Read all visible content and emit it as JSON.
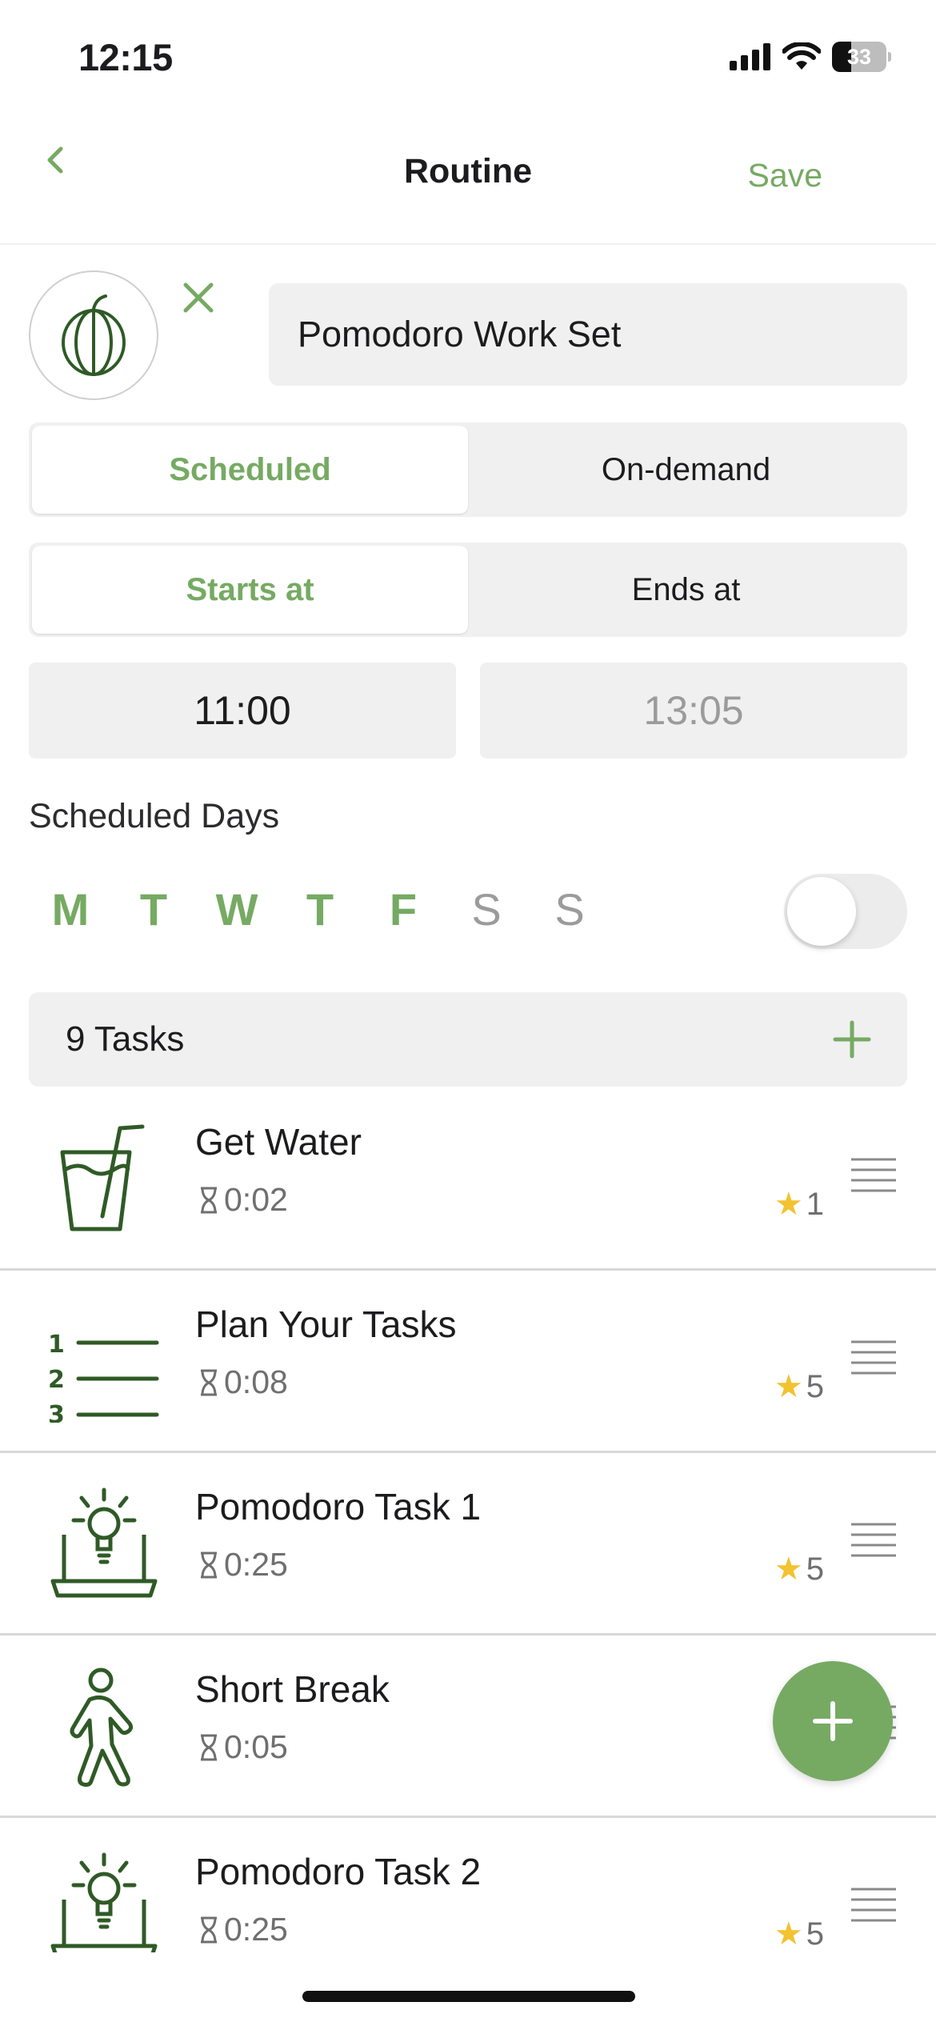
{
  "status_bar": {
    "time": "12:15",
    "battery": "33"
  },
  "nav": {
    "title": "Routine",
    "save_label": "Save"
  },
  "routine": {
    "name": "Pomodoro Work Set",
    "icon": "pumpkin-icon"
  },
  "mode_toggle": {
    "options": [
      "Scheduled",
      "On-demand"
    ],
    "selected": "Scheduled"
  },
  "time_toggle": {
    "options": [
      "Starts at",
      "Ends at"
    ],
    "selected": "Starts at"
  },
  "times": {
    "start": "11:00",
    "end": "13:05"
  },
  "schedule": {
    "label": "Scheduled Days",
    "days": [
      {
        "letter": "M",
        "active": true
      },
      {
        "letter": "T",
        "active": true
      },
      {
        "letter": "W",
        "active": true
      },
      {
        "letter": "T",
        "active": true
      },
      {
        "letter": "F",
        "active": true
      },
      {
        "letter": "S",
        "active": false
      },
      {
        "letter": "S",
        "active": false
      }
    ],
    "toggle_on": false
  },
  "tasks_header": {
    "count_label": "9 Tasks"
  },
  "tasks": [
    {
      "name": "Get Water",
      "duration": "0:02",
      "stars": "1",
      "icon": "water-glass-icon"
    },
    {
      "name": "Plan Your Tasks",
      "duration": "0:08",
      "stars": "5",
      "icon": "numbered-list-icon"
    },
    {
      "name": "Pomodoro Task 1",
      "duration": "0:25",
      "stars": "5",
      "icon": "laptop-idea-icon"
    },
    {
      "name": "Short Break",
      "duration": "0:05",
      "stars": "",
      "icon": "walking-person-icon"
    },
    {
      "name": "Pomodoro Task 2",
      "duration": "0:25",
      "stars": "5",
      "icon": "laptop-idea-icon"
    }
  ],
  "colors": {
    "accent": "#76aa63",
    "icon_dark": "#2f5a26",
    "star": "#f2c230",
    "field_bg": "#f0f0f0"
  }
}
